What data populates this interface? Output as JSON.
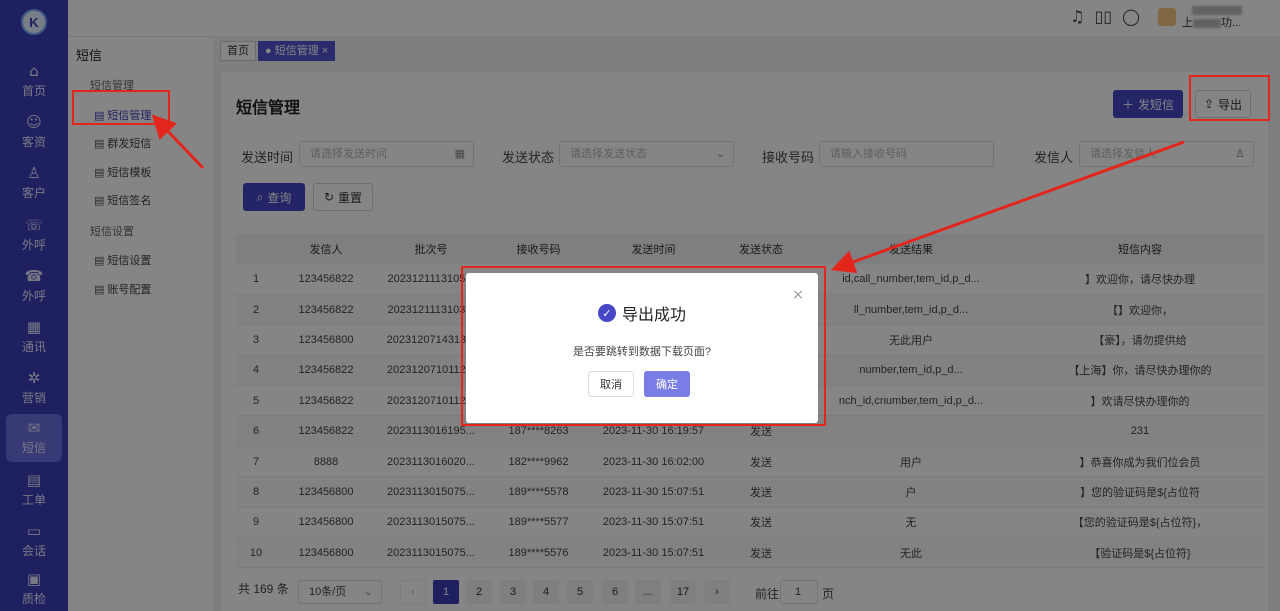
{
  "nav": {
    "logo": "K",
    "items": [
      {
        "label": "首页",
        "icon": "⌂"
      },
      {
        "label": "客资",
        "icon": "☺"
      },
      {
        "label": "客户",
        "icon": "♙"
      },
      {
        "label": "外呼",
        "icon": "☏"
      },
      {
        "label": "外呼",
        "icon": "☎"
      },
      {
        "label": "通讯",
        "icon": "▦"
      },
      {
        "label": "营销",
        "icon": "✲"
      },
      {
        "label": "短信",
        "icon": "✉"
      },
      {
        "label": "工单",
        "icon": "▤"
      },
      {
        "label": "会话",
        "icon": "▭"
      },
      {
        "label": "质检",
        "icon": "▣"
      }
    ],
    "active_index": 7
  },
  "topbar": {
    "icons": [
      "headset-icon",
      "book-icon",
      "chat-icon"
    ],
    "icon_glyphs": [
      "♫",
      "▯▯",
      "◯"
    ],
    "username_prefix": "上",
    "username_suffix": "功..."
  },
  "subside": {
    "title": "短信",
    "group1": "短信管理",
    "group1_items": [
      "短信管理",
      "群发短信",
      "短信模板",
      "短信签名"
    ],
    "group2": "短信设置",
    "group2_items": [
      "短信设置",
      "账号配置"
    ]
  },
  "tabs": {
    "home": "首页",
    "current": "短信管理",
    "close": "×"
  },
  "page": {
    "title": "短信管理",
    "send_sms": "发短信",
    "export": "导出"
  },
  "filters": {
    "send_time_label": "发送时间",
    "send_time_placeholder": "请选择发送时间",
    "status_label": "发送状态",
    "status_placeholder": "请选择发送状态",
    "receiver_label": "接收号码",
    "receiver_placeholder": "请输入接收号码",
    "sender_label": "发信人",
    "sender_placeholder": "请选择发信人",
    "query": "查询",
    "reset": "重置"
  },
  "table": {
    "headers": [
      "",
      "发信人",
      "批次号",
      "接收号码",
      "发送时间",
      "发送状态",
      "发送结果",
      "短信内容"
    ],
    "rows": [
      {
        "idx": "1",
        "sender": "123456822",
        "batch": "2023121113105...",
        "phone": "",
        "time": "",
        "status": "",
        "result": "id,call_number,tem_id,p_d...",
        "content": "】欢迎你，请尽快办理"
      },
      {
        "idx": "2",
        "sender": "123456822",
        "batch": "2023121113103...",
        "phone": "",
        "time": "",
        "status": "",
        "result": "ll_number,tem_id,p_d...",
        "content": "【】欢迎你，"
      },
      {
        "idx": "3",
        "sender": "123456800",
        "batch": "2023120714313...",
        "phone": "",
        "time": "",
        "status": "",
        "result": "无此用户",
        "content": "【豪】，请勿提供给"
      },
      {
        "idx": "4",
        "sender": "123456822",
        "batch": "2023120710112...",
        "phone": "",
        "time": "",
        "status": "",
        "result": "number,tem_id,p_d...",
        "content": "【上海】你，请尽快办理你的"
      },
      {
        "idx": "5",
        "sender": "123456822",
        "batch": "2023120710112...",
        "phone": "",
        "time": "",
        "status": "",
        "result": "nch_id,cnumber,tem_id,p_d...",
        "content": "】欢请尽快办理你的"
      },
      {
        "idx": "6",
        "sender": "123456822",
        "batch": "2023113016195...",
        "phone": "187****8263",
        "time": "2023-11-30 16:19:57",
        "status": "发送",
        "result": "",
        "content": "231"
      },
      {
        "idx": "7",
        "sender": "8888",
        "batch": "2023113016020...",
        "phone": "182****9962",
        "time": "2023-11-30 16:02:00",
        "status": "发送",
        "result": "用户",
        "content": "】恭喜你成为我们位会员"
      },
      {
        "idx": "8",
        "sender": "123456800",
        "batch": "2023113015075...",
        "phone": "189****5578",
        "time": "2023-11-30 15:07:51",
        "status": "发送",
        "result": "户",
        "content": "】您的验证码是${占位符"
      },
      {
        "idx": "9",
        "sender": "123456800",
        "batch": "2023113015075...",
        "phone": "189****5577",
        "time": "2023-11-30 15:07:51",
        "status": "发送",
        "result": "无",
        "content": "【您的验证码是${占位符}，"
      },
      {
        "idx": "10",
        "sender": "123456800",
        "batch": "2023113015075...",
        "phone": "189****5576",
        "time": "2023-11-30 15:07:51",
        "status": "发送",
        "result": "无此",
        "content": "【验证码是${占位符}"
      }
    ]
  },
  "pager": {
    "total": "共 169 条",
    "page_size": "10条/页",
    "pages": [
      "1",
      "2",
      "3",
      "4",
      "5",
      "6",
      "...",
      "17"
    ],
    "prev": "‹",
    "next": "›",
    "goto_prefix": "前往",
    "goto_value": "1",
    "goto_suffix": "页"
  },
  "dialog": {
    "title": "导出成功",
    "message": "是否要跳转到数据下载页面?",
    "cancel": "取消",
    "confirm": "确定",
    "close": "×"
  },
  "colors": {
    "nav_bg": "#3c3fb8",
    "primary": "#4547c4",
    "annotation": "#e3261b"
  }
}
